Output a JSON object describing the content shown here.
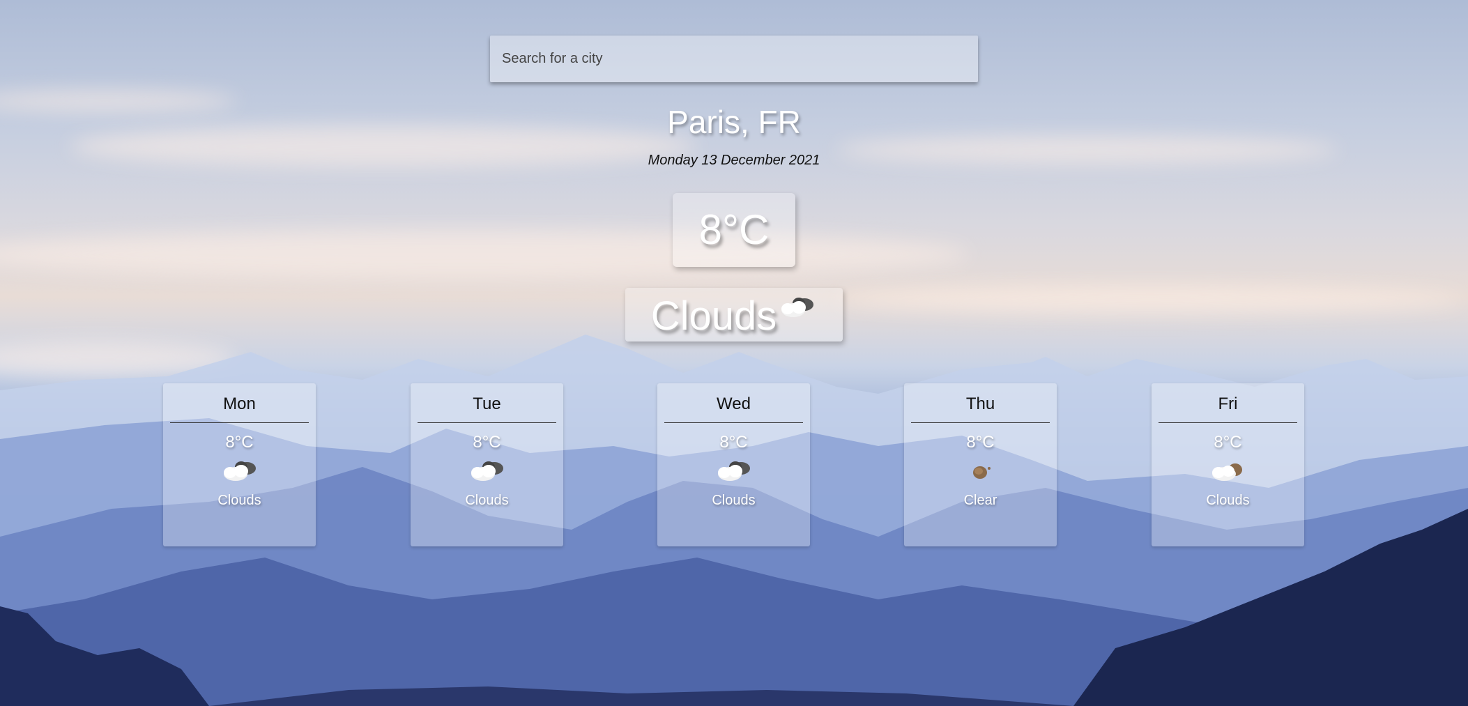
{
  "search": {
    "placeholder": "Search for a city",
    "value": ""
  },
  "location": "Paris, FR",
  "date": "Monday 13 December 2021",
  "current": {
    "temperature": "8°C",
    "condition": "Clouds",
    "icon": "clouds-icon"
  },
  "forecast": [
    {
      "day": "Mon",
      "temp": "8°C",
      "icon": "clouds-icon",
      "desc": "Clouds"
    },
    {
      "day": "Tue",
      "temp": "8°C",
      "icon": "clouds-icon",
      "desc": "Clouds"
    },
    {
      "day": "Wed",
      "temp": "8°C",
      "icon": "clouds-icon",
      "desc": "Clouds"
    },
    {
      "day": "Thu",
      "temp": "8°C",
      "icon": "clear-icon",
      "desc": "Clear"
    },
    {
      "day": "Fri",
      "temp": "8°C",
      "icon": "clouds-icon",
      "desc": "Clouds"
    }
  ]
}
